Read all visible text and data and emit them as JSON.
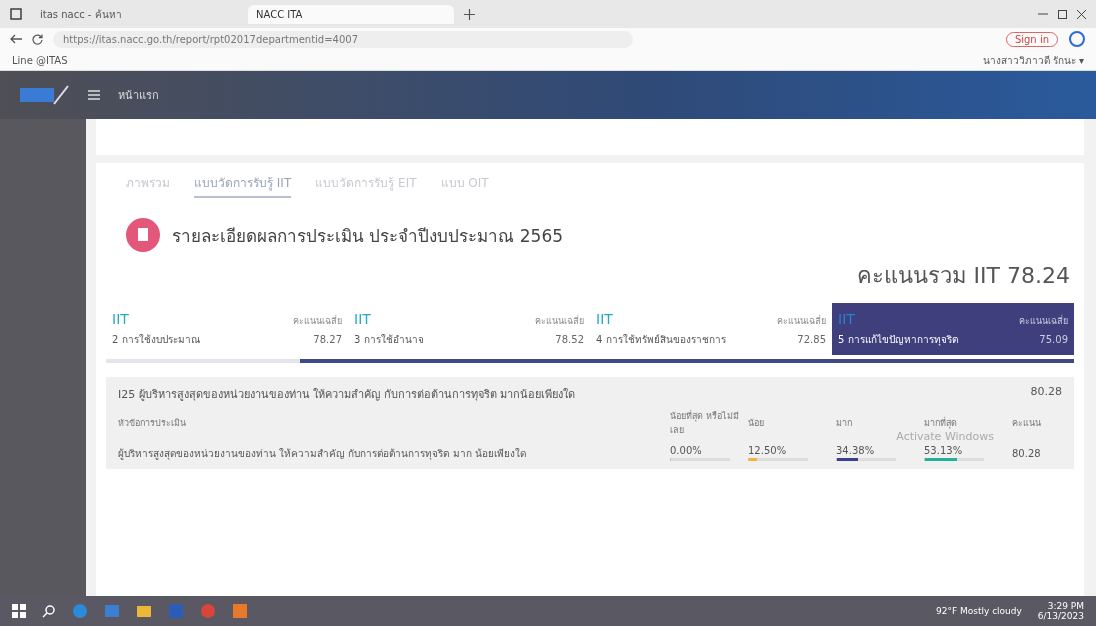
{
  "browser": {
    "tabs": [
      {
        "label": "itas nacc - ค้นหา",
        "selected": false
      },
      {
        "label": "NACC ITA",
        "selected": true
      }
    ],
    "url": "https://itas.nacc.go.th/report/rpt02017departmentid=4007",
    "sign_in": "Sign in",
    "bookmark": "Line @ITAS"
  },
  "header": {
    "user": "นางสาววิภาวดี รักนะ ▾",
    "nav": "หน้าแรก"
  },
  "tabs": [
    {
      "label": "ภาพรวม",
      "selected": false
    },
    {
      "label": "แบบวัดการรับรู้ IIT",
      "selected": true
    },
    {
      "label": "แบบวัดการรับรู้ EIT",
      "selected": false
    },
    {
      "label": "แบบ OIT",
      "selected": false
    }
  ],
  "title": "รายละเอียดผลการประเมิน ประจำปีงบประมาณ 2565",
  "total": "คะแนนรวม IIT 78.24",
  "cards": [
    {
      "tag": "IIT",
      "avg_label": "คะแนนเฉลี่ย",
      "name": "2 การใช้งบประมาณ",
      "score": "78.27",
      "selected": false
    },
    {
      "tag": "IIT",
      "avg_label": "คะแนนเฉลี่ย",
      "name": "3 การใช้อำนาจ",
      "score": "78.52",
      "selected": false
    },
    {
      "tag": "IIT",
      "avg_label": "คะแนนเฉลี่ย",
      "name": "4 การใช้ทรัพย์สินของราชการ",
      "score": "72.85",
      "selected": false
    },
    {
      "tag": "IIT",
      "avg_label": "คะแนนเฉลี่ย",
      "name": "5 การแก้ไขปัญหาการทุจริต",
      "score": "75.09",
      "selected": true
    }
  ],
  "question": {
    "title": "I25 ผู้บริหารสูงสุดของหน่วยงานของท่าน ให้ความสำคัญ กับการต่อต้านการทุจริต มากน้อยเพียงใด",
    "score": "80.28",
    "columns": [
      "หัวข้อการประเมิน",
      "น้อยที่สุด หรือไม่มี เลย",
      "น้อย",
      "มาก",
      "มากที่สุด",
      "คะแนน"
    ],
    "row": {
      "topic": "ผู้บริหารสูงสุดของหน่วยงานของท่าน ให้ความสำคัญ กับการต่อต้านการทุจริต มาก น้อยเพียงใด",
      "score": "80.28",
      "answers": [
        {
          "value": "0.00%",
          "level": 0
        },
        {
          "value": "12.50%",
          "level": 0.125,
          "color": "#f2b632"
        },
        {
          "value": "34.38%",
          "level": 0.3438,
          "color": "#3b3f8f"
        },
        {
          "value": "53.13%",
          "level": 0.5313,
          "color": "#1fb39a"
        }
      ]
    }
  },
  "activation": "Activate Windows",
  "taskbar": {
    "weather": "92°F Mostly cloudy",
    "time": "3:29 PM",
    "date": "6/13/2023"
  }
}
